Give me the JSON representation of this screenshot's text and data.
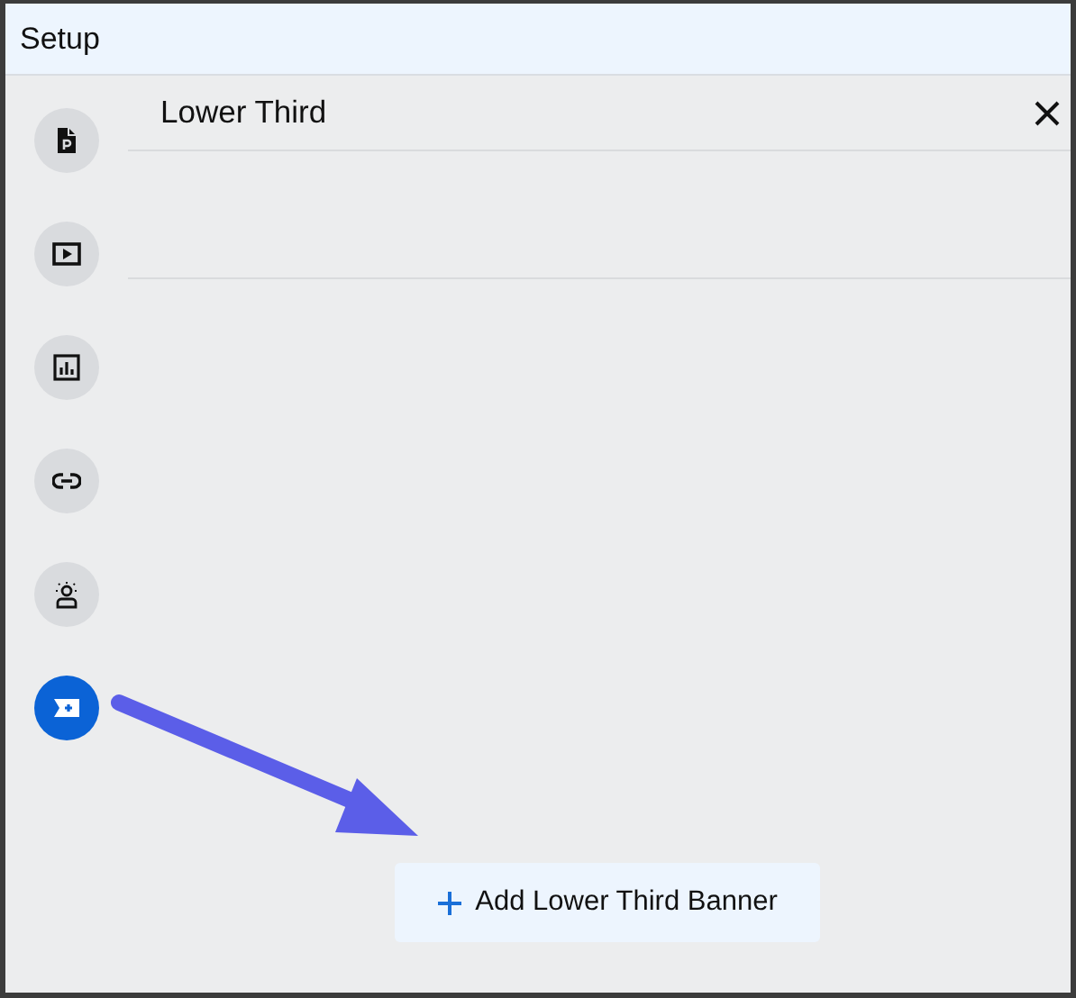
{
  "window": {
    "title": "Setup"
  },
  "tools": [
    {
      "kind": "document",
      "selected": false
    },
    {
      "kind": "video",
      "selected": false
    },
    {
      "kind": "chart",
      "selected": false
    },
    {
      "kind": "link",
      "selected": false
    },
    {
      "kind": "person",
      "selected": false
    },
    {
      "kind": "banner",
      "selected": true
    }
  ],
  "panel": {
    "title": "Lower Third",
    "add_button": "Add Lower Third Banner"
  },
  "annotation": {
    "kind": "arrow"
  }
}
